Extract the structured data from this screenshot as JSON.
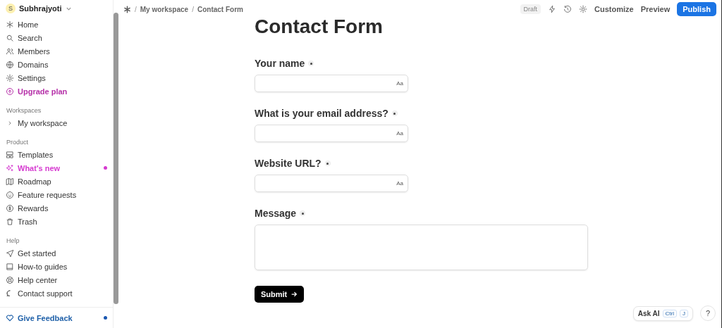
{
  "sidebar": {
    "account": {
      "initial": "S",
      "name": "Subhrajyoti"
    },
    "sections": [
      {
        "items": [
          {
            "label": "Home",
            "dot": false
          },
          {
            "label": "Search",
            "dot": false
          },
          {
            "label": "Members",
            "dot": false
          },
          {
            "label": "Domains",
            "dot": false
          },
          {
            "label": "Settings",
            "dot": false
          },
          {
            "label": "Upgrade plan",
            "dot": false,
            "color": "#b52fa8"
          }
        ]
      },
      {
        "heading": "Workspaces",
        "items": [
          {
            "label": "My workspace",
            "dot": false,
            "expanded": false
          }
        ]
      },
      {
        "heading": "Product",
        "items": [
          {
            "label": "Templates",
            "dot": false
          },
          {
            "label": "What's new",
            "dot": true,
            "color": "#d63ad0"
          },
          {
            "label": "Roadmap",
            "dot": false
          },
          {
            "label": "Feature requests",
            "dot": false
          },
          {
            "label": "Rewards",
            "dot": false
          },
          {
            "label": "Trash",
            "dot": false
          }
        ]
      },
      {
        "heading": "Help",
        "items": [
          {
            "label": "Get started",
            "dot": false
          },
          {
            "label": "How-to guides",
            "dot": false
          },
          {
            "label": "Help center",
            "dot": false
          },
          {
            "label": "Contact support",
            "dot": false
          }
        ]
      }
    ],
    "feedback": {
      "label": "Give Feedback",
      "dot": true
    }
  },
  "breadcrumb": {
    "separator": "/",
    "items": [
      "My workspace",
      "Contact Form"
    ]
  },
  "toolbar": {
    "status": "Draft",
    "links": [
      "Customize",
      "Preview"
    ],
    "primary": "Publish"
  },
  "form": {
    "title": "Contact Form",
    "fields": [
      {
        "label": "Your name",
        "required": true,
        "kind": "text",
        "hint": "Aa"
      },
      {
        "label": "What is your email address?",
        "required": true,
        "kind": "text",
        "hint": "Aa"
      },
      {
        "label": "Website URL?",
        "required": true,
        "kind": "text",
        "hint": "Aa"
      },
      {
        "label": "Message",
        "required": true,
        "kind": "textarea"
      }
    ],
    "submit": "Submit"
  },
  "ask_ai": {
    "label": "Ask AI",
    "keys": [
      "Ctrl",
      "J"
    ]
  },
  "help": "?"
}
